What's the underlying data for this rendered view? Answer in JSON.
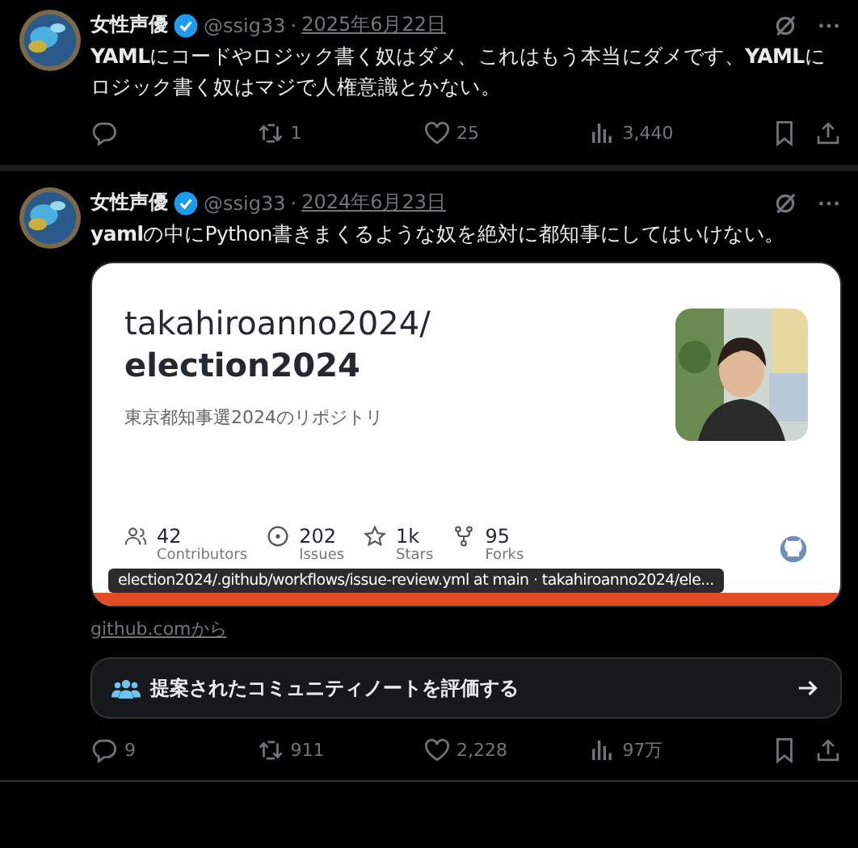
{
  "tweets": [
    {
      "author": "女性声優",
      "verified": true,
      "handle": "@ssig33",
      "separator": "·",
      "date": "2025年6月22日",
      "text": "**YAML**にコードやロジック書く奴はダメ、これはもう本当にダメです、**YAML**にロジック書く奴はマジで人権意識とかない。",
      "actions": [
        {
          "kind": "reply"
        },
        {
          "kind": "repost",
          "count": "1"
        },
        {
          "kind": "like",
          "count": "25"
        },
        {
          "kind": "views",
          "count": "3,440"
        },
        {
          "kind": "bookmark"
        },
        {
          "kind": "share"
        }
      ]
    },
    {
      "author": "女性声優",
      "verified": true,
      "handle": "@ssig33",
      "separator": "·",
      "date": "2024年6月23日",
      "text": "**yaml**の中にPython書きまくるような奴を絶対に都知事にしてはいけない。",
      "card": {
        "title_line_1": "takahiroanno2024/",
        "title_line_2": "election2024",
        "description": "東京都知事選2024のリポジトリ",
        "stats": [
          {
            "kind": "contributors",
            "count": "42",
            "label": "Contributors"
          },
          {
            "kind": "issues",
            "count": "202",
            "label": "Issues"
          },
          {
            "kind": "stars",
            "count": "1k",
            "label": "Stars"
          },
          {
            "kind": "forks",
            "count": "95",
            "label": "Forks"
          }
        ],
        "tooltip": "election2024/.github/workflows/issue-review.yml at main · takahiroanno2024/ele...",
        "source": "github.comから"
      },
      "community_note_button": "提案されたコミュニティノートを評価する",
      "actions": [
        {
          "kind": "reply",
          "count": "9"
        },
        {
          "kind": "repost",
          "count": "911"
        },
        {
          "kind": "like",
          "count": "2,228"
        },
        {
          "kind": "views",
          "count": "97万"
        },
        {
          "kind": "bookmark"
        },
        {
          "kind": "share"
        }
      ]
    }
  ]
}
